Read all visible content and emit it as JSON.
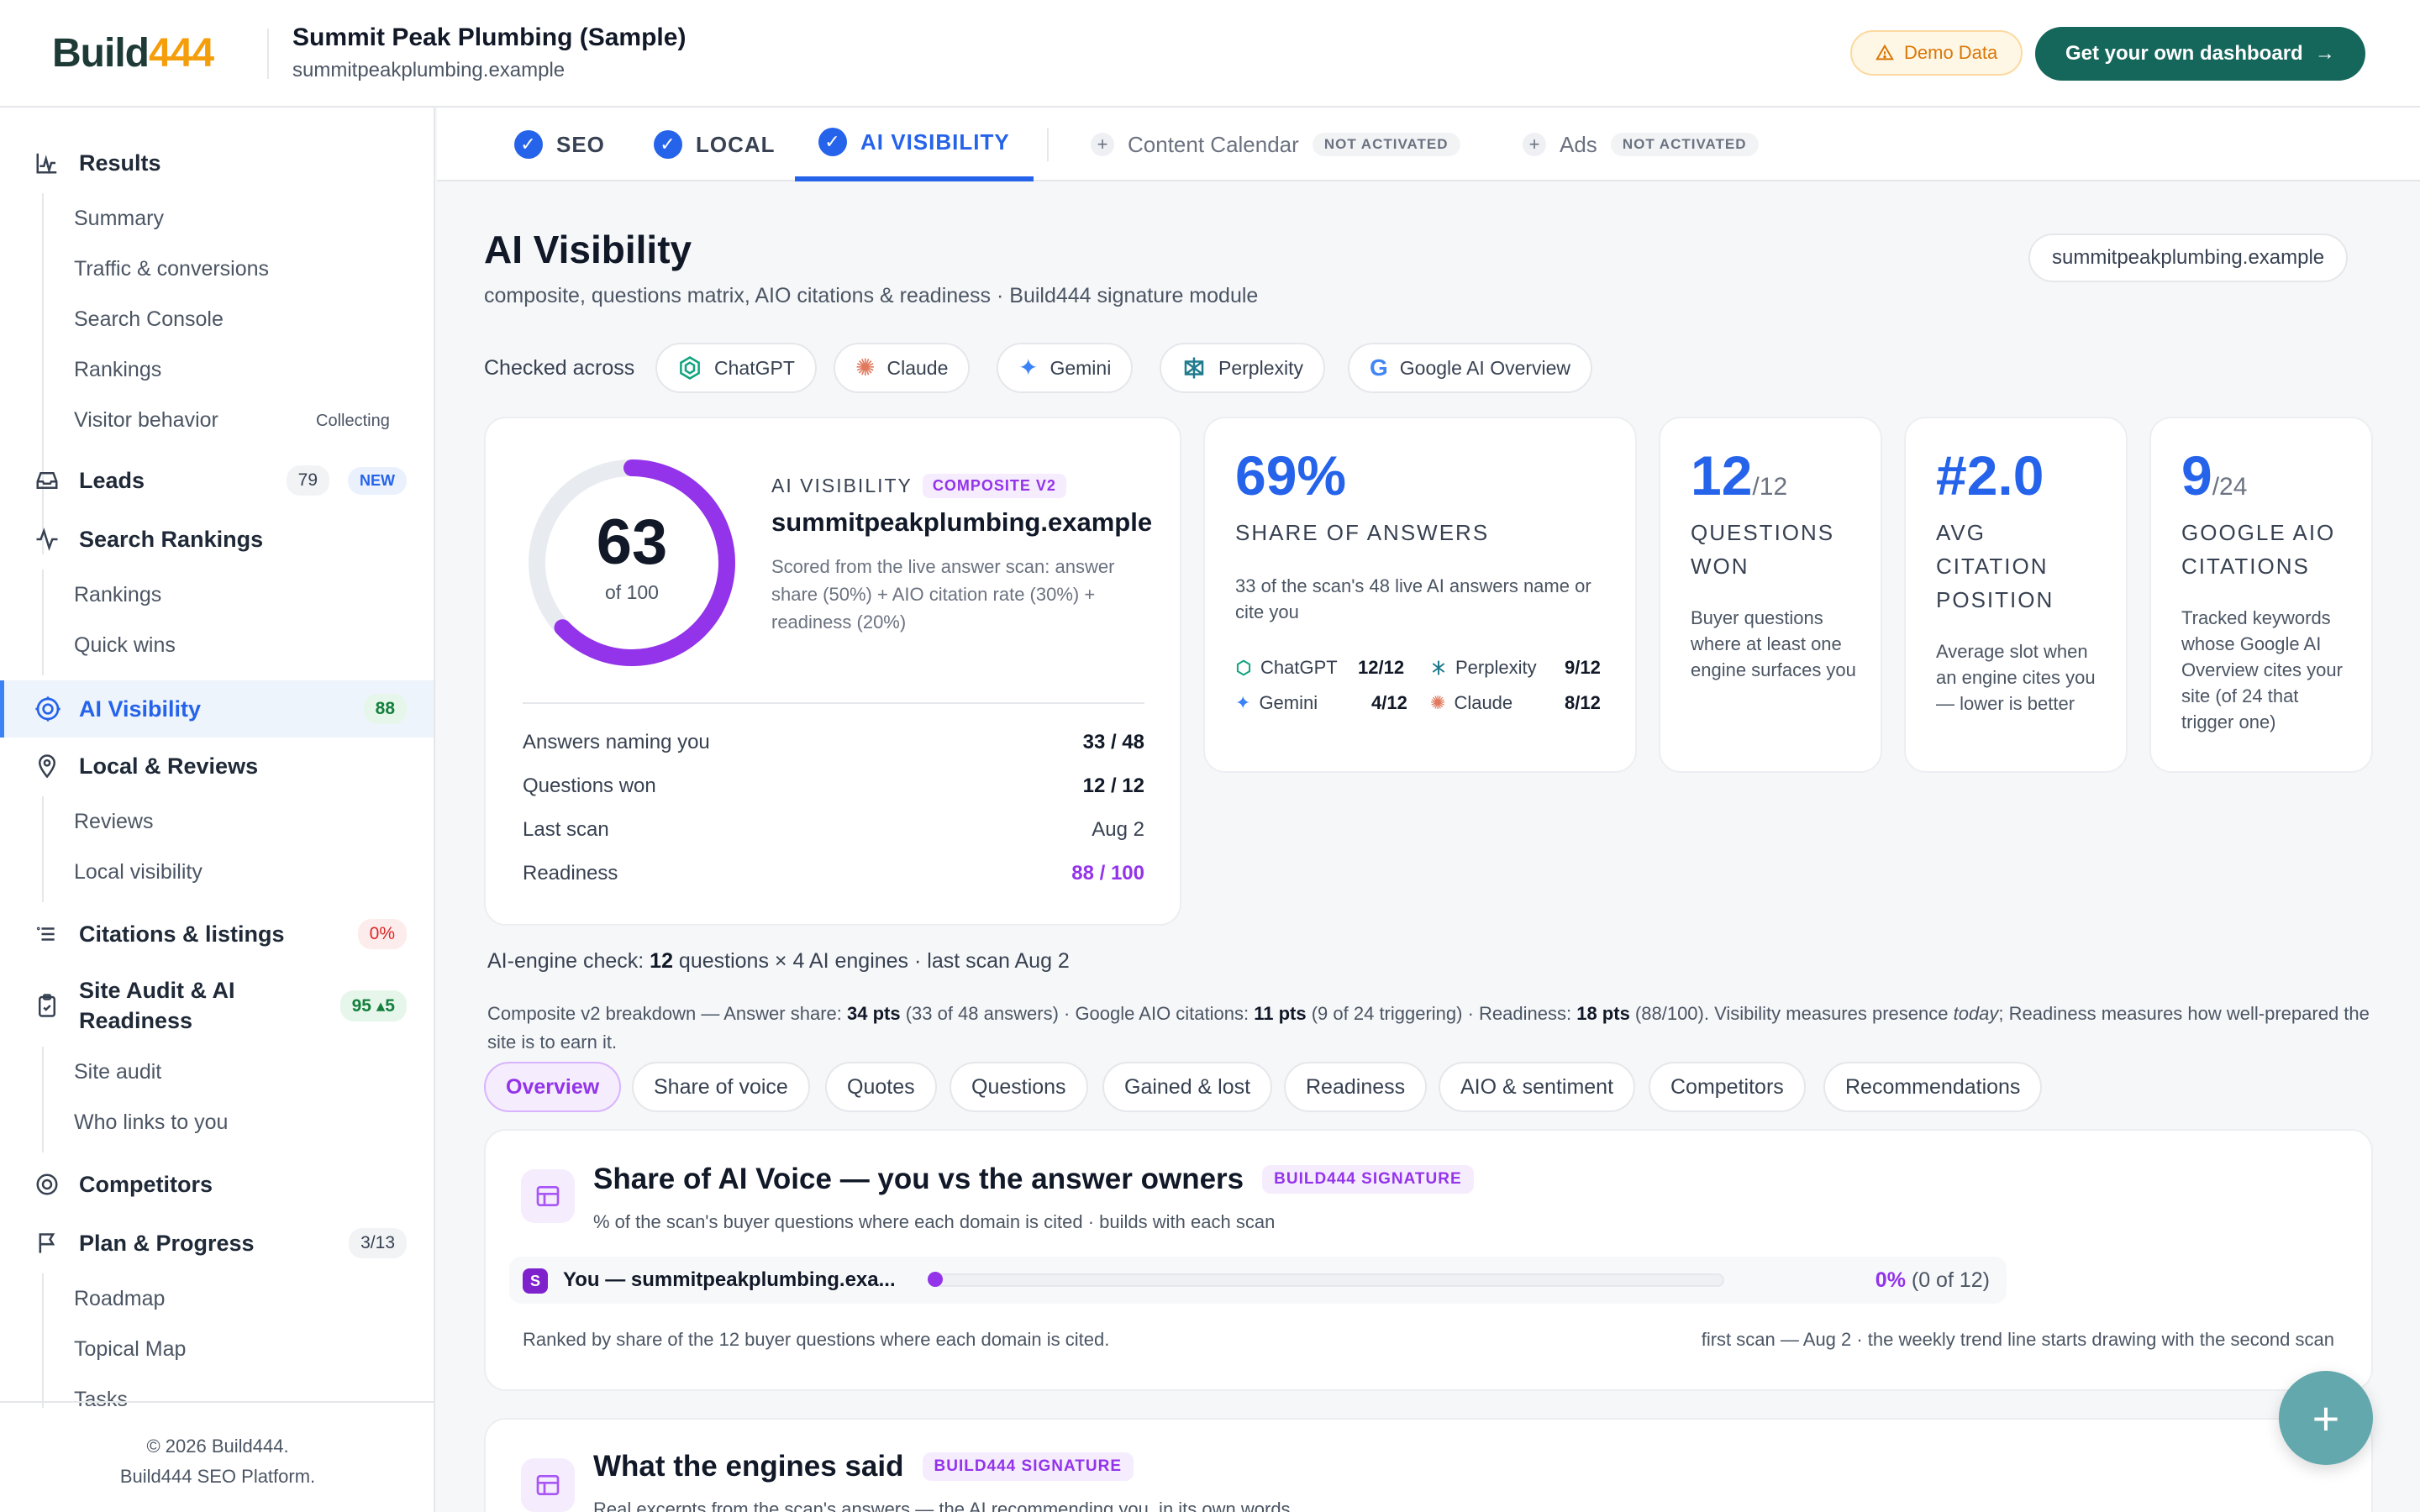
{
  "header": {
    "logo_prefix": "Build",
    "logo_number": "444",
    "site_title": "Summit Peak Plumbing (Sample)",
    "site_url": "summitpeakplumbing.example",
    "demo_badge": "Demo Data",
    "cta_label": "Get your own dashboard"
  },
  "sidebar": {
    "results": "Results",
    "results_items": [
      "Summary",
      "Traffic & conversions",
      "Search Console",
      "Rankings",
      "Visitor behavior"
    ],
    "collecting": "Collecting",
    "leads": "Leads",
    "leads_count": "79",
    "leads_new": "NEW",
    "search_rankings": "Search Rankings",
    "search_rankings_items": [
      "Rankings",
      "Quick wins"
    ],
    "ai_visibility": "AI Visibility",
    "ai_visibility_count": "88",
    "local_reviews": "Local & Reviews",
    "local_items": [
      "Reviews",
      "Local visibility"
    ],
    "citations": "Citations & listings",
    "citations_count": "0%",
    "site_audit": "Site Audit & AI Readiness",
    "site_audit_count": "95 ▴5",
    "site_audit_items": [
      "Site audit",
      "Who links to you"
    ],
    "competitors": "Competitors",
    "plan": "Plan & Progress",
    "plan_count": "3/13",
    "plan_items": [
      "Roadmap",
      "Topical Map",
      "Tasks"
    ],
    "footer_line1": "© 2026 Build444.",
    "footer_line2": "Build444 SEO Platform."
  },
  "tabs": {
    "seo": "SEO",
    "local": "LOCAL",
    "ai_visibility": "AI VISIBILITY",
    "content_calendar": "Content Calendar",
    "ads": "Ads",
    "not_activated": "NOT ACTIVATED"
  },
  "main": {
    "title": "AI Visibility",
    "subtitle": "composite, questions matrix, AIO citations & readiness · Build444 signature module",
    "domain_pill": "summitpeakplumbing.example",
    "checked_across": "Checked across",
    "engines": [
      "ChatGPT",
      "Claude",
      "Gemini",
      "Perplexity",
      "Google AI Overview"
    ]
  },
  "score_card": {
    "score": "63",
    "of": "of 100",
    "score_value": 63,
    "label": "AI VISIBILITY",
    "badge": "COMPOSITE V2",
    "domain": "summitpeakplumbing.example",
    "desc": "Scored from the live answer scan: answer share (50%) + AIO citation rate (30%) + readiness (20%)",
    "rows": [
      {
        "k": "Answers naming you",
        "v": "33 / 48"
      },
      {
        "k": "Questions won",
        "v": "12 / 12"
      },
      {
        "k": "Last scan",
        "v": "Aug 2"
      },
      {
        "k": "Readiness",
        "v": "88 / 100"
      }
    ]
  },
  "share_card": {
    "big": "69%",
    "label": "SHARE OF ANSWERS",
    "desc": "33 of the scan's 48 live AI answers name or cite you",
    "engines": [
      {
        "name": "ChatGPT",
        "score": "12/12"
      },
      {
        "name": "Perplexity",
        "score": "9/12"
      },
      {
        "name": "Gemini",
        "score": "4/12"
      },
      {
        "name": "Claude",
        "score": "8/12"
      }
    ]
  },
  "won_card": {
    "big": "12",
    "small": "/12",
    "label": "QUESTIONS WON",
    "desc": "Buyer questions where at least one engine surfaces you"
  },
  "cit_card": {
    "big": "#2.0",
    "label": "AVG CITATION POSITION",
    "desc": "Average slot when an engine cites you — lower is better"
  },
  "aio_card": {
    "big": "9",
    "small": "/24",
    "label": "GOOGLE AIO CITATIONS",
    "desc": "Tracked keywords whose Google AI Overview cites your site (of 24 that trigger one)"
  },
  "engine_check": {
    "prefix": "AI-engine check: ",
    "questions": "12",
    "suffix": " questions × 4 AI engines · last scan Aug 2"
  },
  "breakdown": {
    "a": "Composite v2 breakdown — Answer share: ",
    "b": "34 pts",
    "c": " (33 of 48 answers) · Google AIO citations: ",
    "d": "11 pts",
    "e": " (9 of 24 triggering) · Readiness: ",
    "f": "18 pts",
    "g": " (88/100). Visibility measures presence ",
    "h": "today",
    "i": "; Readiness measures how well-prepared the site is to earn it."
  },
  "subtabs": [
    "Overview",
    "Share of voice",
    "Quotes",
    "Questions",
    "Gained & lost",
    "Readiness",
    "AIO & sentiment",
    "Competitors",
    "Recommendations"
  ],
  "voice": {
    "title": "Share of AI Voice — you vs the answer owners",
    "badge": "BUILD444 SIGNATURE",
    "subtitle": "% of the scan's buyer questions where each domain is cited · builds with each scan",
    "you_letter": "S",
    "you_label": "You — summitpeakplumbing.exa...",
    "pct": "0%",
    "pct_detail": " (0 of 12)",
    "fill_fraction": 0,
    "foot_left": "Ranked by share of the 12 buyer questions where each domain is cited.",
    "foot_right": "first scan — Aug 2 · the weekly trend line starts drawing with the second scan"
  },
  "said": {
    "title": "What the engines said",
    "badge": "BUILD444 SIGNATURE",
    "subtitle": "Real excerpts from the scan's answers — the AI recommending you, in its own words"
  },
  "colors": {
    "brand": "#15675b",
    "accent": "#2563eb",
    "purple": "#9333ea",
    "logo_number": "#f59e0b"
  }
}
